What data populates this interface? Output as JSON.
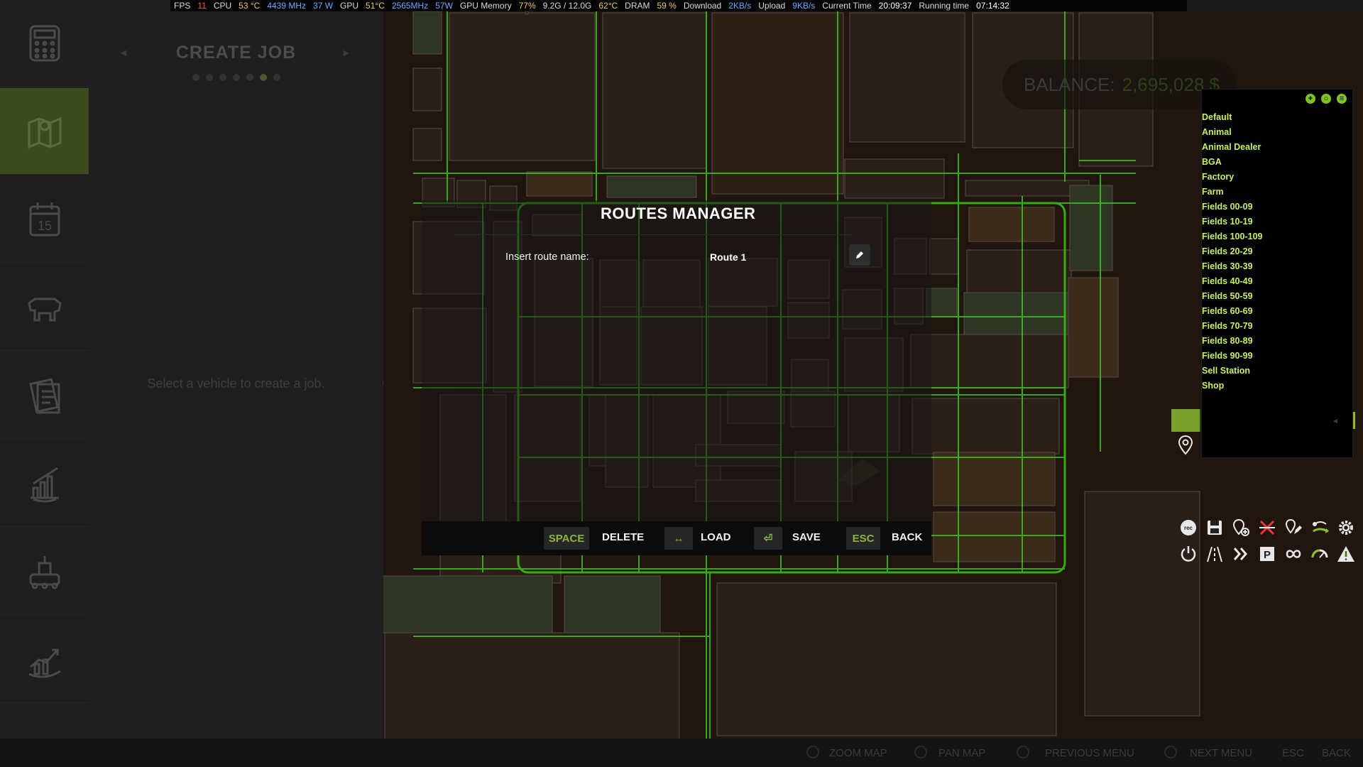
{
  "stats": [
    {
      "text": "FPS",
      "cls": "s-lbl"
    },
    {
      "text": "11",
      "cls": "s-red"
    },
    {
      "text": "CPU",
      "cls": "s-lbl"
    },
    {
      "text": "53 °C",
      "cls": "s-yel"
    },
    {
      "text": "4439 MHz",
      "cls": "s-blu"
    },
    {
      "text": "37 W",
      "cls": "s-blu"
    },
    {
      "text": "GPU",
      "cls": "s-lbl"
    },
    {
      "text": "51°C",
      "cls": "s-yel"
    },
    {
      "text": "2565MHz",
      "cls": "s-blu"
    },
    {
      "text": "57W",
      "cls": "s-blu"
    },
    {
      "text": "GPU Memory",
      "cls": "s-lbl"
    },
    {
      "text": "77%",
      "cls": "s-yel"
    },
    {
      "text": "9.2G / 12.0G",
      "cls": "s-lbl"
    },
    {
      "text": "62°C",
      "cls": "s-yel"
    },
    {
      "text": "DRAM",
      "cls": "s-lbl"
    },
    {
      "text": "59 %",
      "cls": "s-yel"
    },
    {
      "text": "Download",
      "cls": "s-lbl"
    },
    {
      "text": "2KB/s",
      "cls": "s-blu"
    },
    {
      "text": "Upload",
      "cls": "s-lbl"
    },
    {
      "text": "9KB/s",
      "cls": "s-blu"
    },
    {
      "text": "Current Time",
      "cls": "s-lbl"
    },
    {
      "text": "20:09:37",
      "cls": "s-wht"
    },
    {
      "text": "Running time",
      "cls": "s-lbl"
    },
    {
      "text": "07:14:32",
      "cls": "s-wht"
    }
  ],
  "sidebar": {
    "items": [
      {
        "name": "calculator-icon",
        "active": false
      },
      {
        "name": "map-icon",
        "active": true
      },
      {
        "name": "calendar-icon",
        "active": false,
        "label": "15"
      },
      {
        "name": "cow-icon",
        "active": false
      },
      {
        "name": "contracts-icon",
        "active": false
      },
      {
        "name": "statistics-icon",
        "active": false
      },
      {
        "name": "production-icon",
        "active": false
      },
      {
        "name": "finance-icon",
        "active": false
      }
    ]
  },
  "job_panel": {
    "title": "CREATE JOB",
    "prev_arrow": "◄",
    "next_arrow": "►",
    "empty_message": "Select a vehicle to create a job.",
    "page_count": 7,
    "active_page": 6
  },
  "balance": {
    "label": "BALANCE:",
    "value": "2,695,028 $"
  },
  "route_list": {
    "items": [
      {
        "label": "Default",
        "dim": false
      },
      {
        "label": "Animal",
        "dim": false
      },
      {
        "label": "Animal Dealer",
        "dim": false
      },
      {
        "label": "BGA",
        "dim": false
      },
      {
        "label": "Factory",
        "dim": false
      },
      {
        "label": "Farm",
        "dim": false
      },
      {
        "label": "Fields 00-09",
        "dim": false
      },
      {
        "label": "Fields 10-19",
        "dim": false
      },
      {
        "label": "Fields 100-109",
        "dim": false
      },
      {
        "label": "Fields 20-29",
        "dim": false
      },
      {
        "label": "Fields 30-39",
        "dim": false
      },
      {
        "label": "Fields 40-49",
        "dim": false
      },
      {
        "label": "Fields 50-59",
        "dim": false
      },
      {
        "label": "Fields 60-69",
        "dim": false
      },
      {
        "label": "Fields 70-79",
        "dim": false
      },
      {
        "label": "Fields 80-89",
        "dim": false
      },
      {
        "label": "Fields 90-99",
        "dim": false
      },
      {
        "label": "Sell Station",
        "dim": false
      },
      {
        "label": "Shop",
        "dim": false
      }
    ]
  },
  "toolbar": {
    "row1": [
      "record-icon",
      "save-icon",
      "add-marker-icon",
      "delete-route-icon",
      "edit-marker-icon",
      "connect-icon",
      "settings-icon"
    ],
    "row2": [
      "power-icon",
      "road-icon",
      "fast-forward-icon",
      "parking-icon",
      "loop-icon",
      "speedometer-icon",
      "warning-icon"
    ]
  },
  "dialog": {
    "title": "ROUTES MANAGER",
    "route_label": "Insert route name:",
    "route_value": "Route 1",
    "keys": {
      "space": "SPACE",
      "delete": "DELETE",
      "load_key": "↔",
      "load": "LOAD",
      "save_key": "⏎",
      "save": "SAVE",
      "esc": "ESC",
      "back": "BACK"
    }
  },
  "bottom_bar": {
    "zoom_map": "ZOOM MAP",
    "pan_map": "PAN MAP",
    "previous_menu": "PREVIOUS MENU",
    "next_menu": "NEXT MENU",
    "esc": "ESC",
    "back": "BACK"
  },
  "colors": {
    "accent_green": "#8ab43a",
    "route_green": "#3cc21a",
    "route_list_text": "#c8f060"
  }
}
